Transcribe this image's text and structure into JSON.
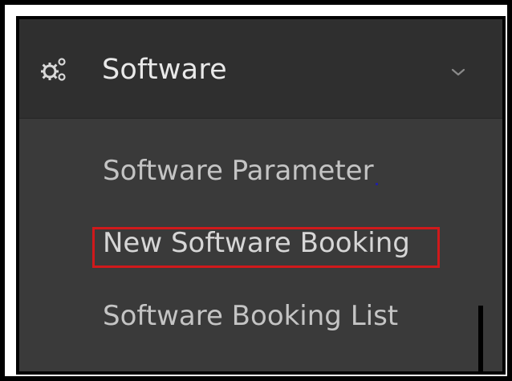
{
  "menu": {
    "header_label": "Software",
    "header_icon": "gears-icon",
    "expand_icon": "chevron-down-icon",
    "items": [
      {
        "label": "Software Parameter"
      },
      {
        "label": "New Software Booking",
        "highlighted": true
      },
      {
        "label": "Software Booking List"
      }
    ]
  },
  "colors": {
    "header_background": "#2f2f2f",
    "submenu_background": "#3a3a3a",
    "highlight_border": "#d0191b",
    "text": "#e9e9e9"
  }
}
